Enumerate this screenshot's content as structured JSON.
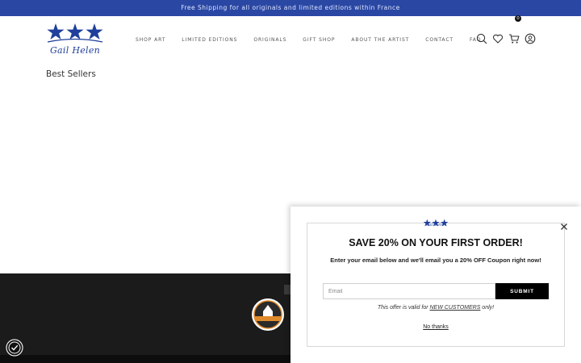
{
  "announcement": {
    "text": "Free Shipping for all originals and limited editions within France"
  },
  "brand": {
    "name": "Gail Helen",
    "color": "#1f3f9c"
  },
  "nav": {
    "items": [
      {
        "label": "SHOP ART"
      },
      {
        "label": "LIMITED EDITIONS"
      },
      {
        "label": "ORIGINALS"
      },
      {
        "label": "GIFT SHOP"
      },
      {
        "label": "ABOUT THE ARTIST"
      },
      {
        "label": "CONTACT"
      },
      {
        "label": "FAQ"
      }
    ]
  },
  "header_icons": [
    "search-icon",
    "heart-icon",
    "cart-icon",
    "account-icon"
  ],
  "cart": {
    "count": "0"
  },
  "main": {
    "section_title": "Best Sellers"
  },
  "popup": {
    "title": "SAVE 20% ON YOUR FIRST ORDER!",
    "description": "Enter your email below and we'll email you a 20% OFF Coupon right now!",
    "email_placeholder": "Email",
    "submit_label": "SUBMIT",
    "offer_prefix": "This offer is valid for ",
    "offer_highlight": "NEW CUSTOMERS",
    "offer_suffix": " only!",
    "no_thanks": "No thanks"
  },
  "colors": {
    "topbar": "#2a47a3",
    "footer": "#1b1b1b",
    "accent": "#000000"
  }
}
